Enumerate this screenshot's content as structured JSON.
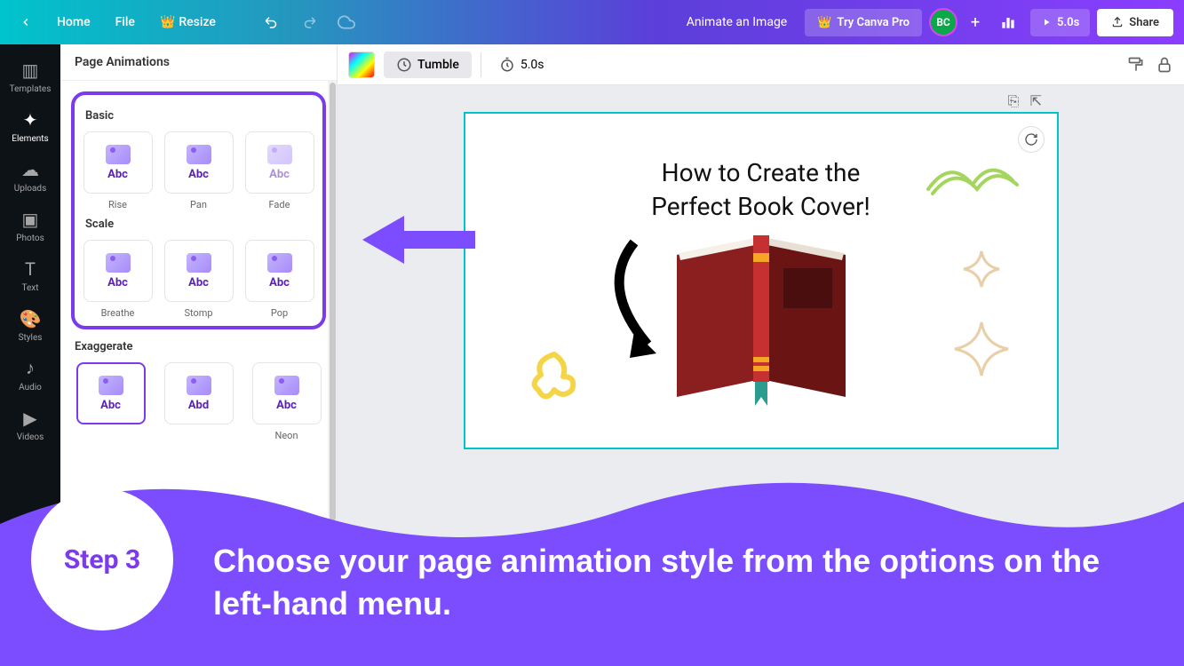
{
  "topbar": {
    "home": "Home",
    "file": "File",
    "resize": "Resize",
    "doc_title": "Animate an Image",
    "try_pro": "Try Canva Pro",
    "avatar": "BC",
    "play_time": "5.0s",
    "share": "Share"
  },
  "rail": {
    "items": [
      {
        "label": "Templates"
      },
      {
        "label": "Elements"
      },
      {
        "label": "Uploads"
      },
      {
        "label": "Photos"
      },
      {
        "label": "Text"
      },
      {
        "label": "Styles"
      },
      {
        "label": "Audio"
      },
      {
        "label": "Videos"
      }
    ]
  },
  "panel": {
    "title": "Page Animations",
    "sections": {
      "basic": {
        "title": "Basic",
        "items": [
          "Rise",
          "Pan",
          "Fade"
        ]
      },
      "scale": {
        "title": "Scale",
        "items": [
          "Breathe",
          "Stomp",
          "Pop"
        ]
      },
      "exaggerate": {
        "title": "Exaggerate",
        "items": [
          "",
          "",
          "Neon"
        ]
      }
    },
    "abc": "Abc",
    "abd": "Abd"
  },
  "toolbar": {
    "animation_name": "Tumble",
    "timer": "5.0s"
  },
  "canvas": {
    "title_line1": "How to Create the",
    "title_line2": "Perfect Book Cover!"
  },
  "footer": {
    "step_label": "Step 3",
    "instruction": "Choose your page animation style from the options on the left-hand menu."
  }
}
